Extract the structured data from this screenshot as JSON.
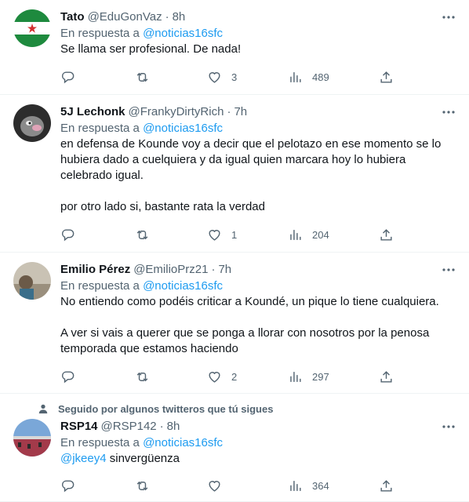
{
  "reply_prefix": "En respuesta a",
  "tweets": [
    {
      "name": "Tato",
      "handle": "@EduGonVaz",
      "time": "8h",
      "reply_to": "@noticias16sfc",
      "text": [
        "Se llama ser profesional. De nada!"
      ],
      "likes": "3",
      "views": "489"
    },
    {
      "name": "5J Lechonk",
      "handle": "@FrankyDirtyRich",
      "time": "7h",
      "reply_to": "@noticias16sfc",
      "text": [
        "en defensa de Kounde voy a decir que el pelotazo en ese momento se lo",
        "hubiera dado a cuelquiera y da igual quien marcara hoy lo hubiera",
        "celebrado igual.",
        "",
        "por otro lado si, bastante rata la verdad"
      ],
      "likes": "1",
      "views": "204"
    },
    {
      "name": "Emilio Pérez",
      "handle": "@EmilioPrz21",
      "time": "7h",
      "reply_to": "@noticias16sfc",
      "text": [
        "No entiendo como podéis criticar a Koundé, un pique lo tiene cualquiera.",
        "",
        "A ver si vais a querer que se ponga a llorar con nosotros por la penosa",
        "temporada que estamos haciendo"
      ],
      "likes": "2",
      "views": "297"
    },
    {
      "social_context": "Seguido por algunos twitteros que tú sigues",
      "name": "RSP14",
      "handle": "@RSP142",
      "time": "8h",
      "reply_to": "@noticias16sfc",
      "text_mention": "@jkeey4",
      "text_rest": " sinvergüenza",
      "views": "364"
    }
  ],
  "colors": {
    "accent": "#1d9bf0",
    "muted": "#536471",
    "text": "#0f1419"
  }
}
